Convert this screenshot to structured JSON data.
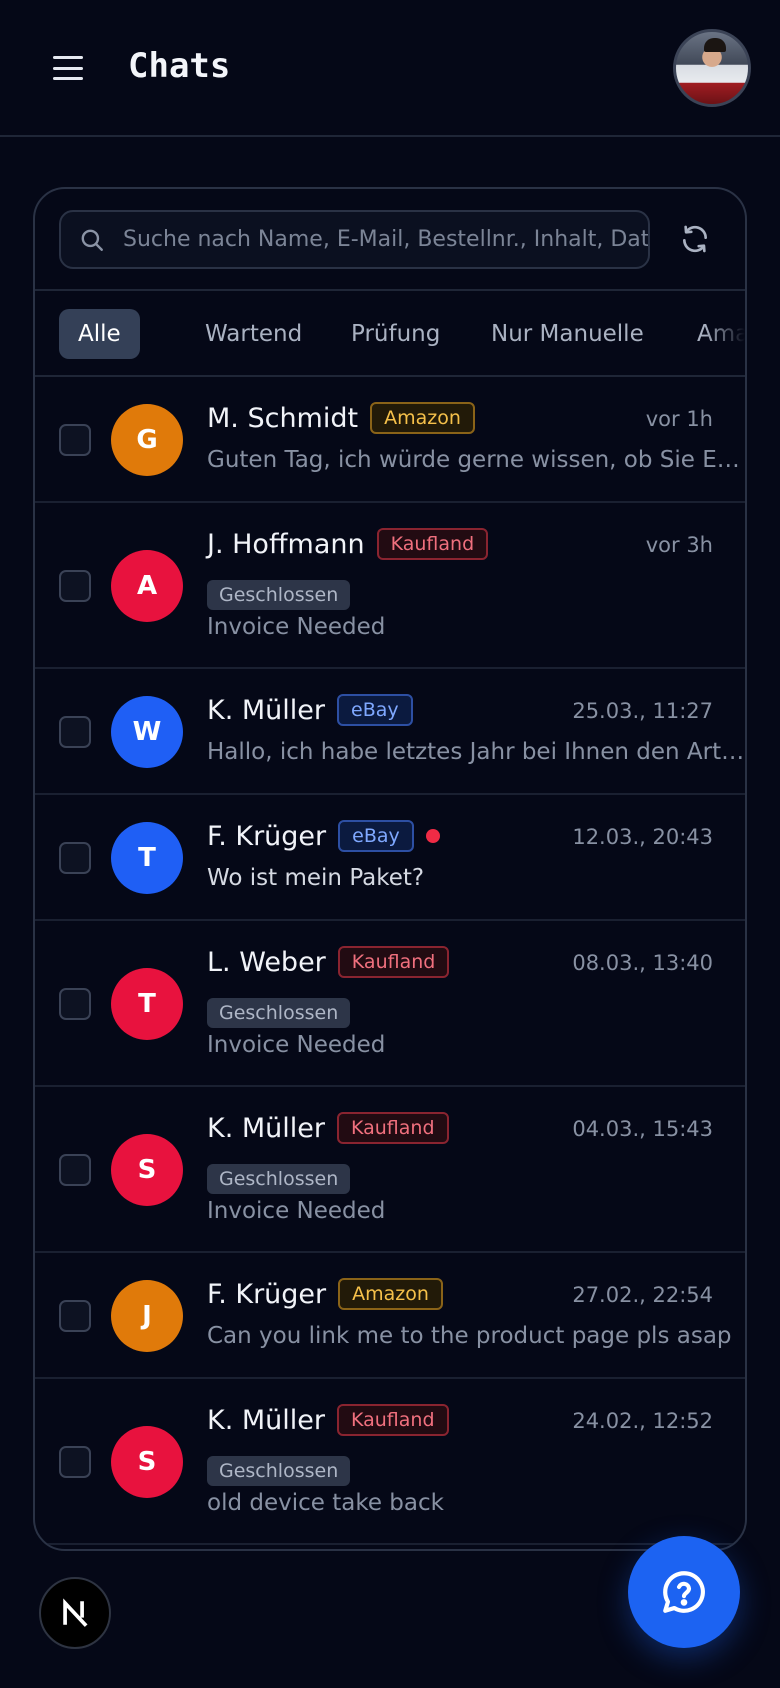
{
  "header": {
    "title": "Chats"
  },
  "search": {
    "placeholder": "Suche nach Name, E-Mail, Bestellnr., Inhalt, Datum"
  },
  "tabs": [
    {
      "label": "Alle",
      "active": true
    },
    {
      "label": "Wartend"
    },
    {
      "label": "Prüfung"
    },
    {
      "label": "Nur Manuelle"
    },
    {
      "label": "Amazon"
    }
  ],
  "colors": {
    "accent": "#1c63f2",
    "amazon": "#e07a0a",
    "kaufland": "#e8123e",
    "ebay": "#1f5ff5"
  },
  "chats": [
    {
      "initial": "G",
      "avatar_color": "#e07a0a",
      "name": "M. Schmidt",
      "marketplace": "Amazon",
      "time": "vor 1h",
      "preview": "Guten Tag, ich würde gerne wissen, ob Sie Ersatzteile liefern",
      "unread": false
    },
    {
      "initial": "A",
      "avatar_color": "#e8123e",
      "name": "J. Hoffmann",
      "marketplace": "Kaufland",
      "time": "vor 3h",
      "status": "Geschlossen",
      "preview": "Invoice Needed",
      "unread": false
    },
    {
      "initial": "W",
      "avatar_color": "#1f5ff5",
      "name": "K. Müller",
      "marketplace": "eBay",
      "time": "25.03., 11:27",
      "preview": "Hallo, ich habe letztes Jahr bei Ihnen den Artikel gekauft",
      "unread": false
    },
    {
      "initial": "T",
      "avatar_color": "#1f5ff5",
      "name": "F. Krüger",
      "marketplace": "eBay",
      "time": "12.03., 20:43",
      "preview": "Wo ist mein Paket?",
      "unread": true
    },
    {
      "initial": "T",
      "avatar_color": "#e8123e",
      "name": "L. Weber",
      "marketplace": "Kaufland",
      "time": "08.03., 13:40",
      "status": "Geschlossen",
      "preview": "Invoice Needed",
      "unread": false
    },
    {
      "initial": "S",
      "avatar_color": "#e8123e",
      "name": "K. Müller",
      "marketplace": "Kaufland",
      "time": "04.03., 15:43",
      "status": "Geschlossen",
      "preview": "Invoice Needed",
      "unread": false
    },
    {
      "initial": "J",
      "avatar_color": "#e07a0a",
      "name": "F. Krüger",
      "marketplace": "Amazon",
      "time": "27.02., 22:54",
      "preview": "Can you link me to the product page pls asap",
      "unread": false
    },
    {
      "initial": "S",
      "avatar_color": "#e8123e",
      "name": "K. Müller",
      "marketplace": "Kaufland",
      "time": "24.02., 12:52",
      "status": "Geschlossen",
      "preview": "old device take back",
      "unread": false
    }
  ],
  "icons": {
    "menu": "menu-icon",
    "search": "search-icon",
    "refresh": "refresh-icon",
    "help": "help-chat-icon",
    "next": "next-logo-icon"
  }
}
